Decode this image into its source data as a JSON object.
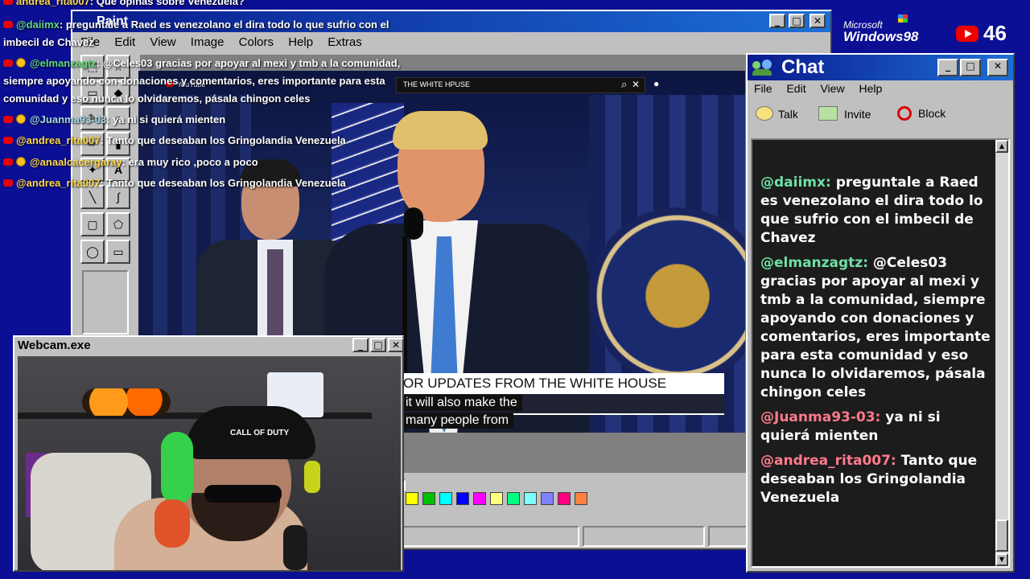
{
  "top_overlay": {
    "lines": [
      {
        "user": "andrea_rita007",
        "text": ": Que opinas sobre Venezuela?"
      },
      {
        "user": "@daiimx",
        "text": ": preguntale a Raed es venezolano el dira todo lo que sufrio con el"
      },
      {
        "cont": "imbecil de Chavez"
      },
      {
        "user": "@elmanzagtz",
        "text": ": @Celes03 gracias por apoyar al mexi y tmb a la comunidad,"
      },
      {
        "cont": "siempre apoyando con donaciones y comentarios, eres importante para esta"
      },
      {
        "cont": "comunidad y eso nunca lo olvidaremos, pásala chingon celes"
      },
      {
        "user": "@Juanma93-03",
        "text": ": ya ni si quierá mienten"
      },
      {
        "user": "@andrea_rita007",
        "text": ": Tanto que deseaban los Gringolandia Venezuela"
      },
      {
        "user": "@anaalcacergaray",
        "text": ": era muy rico ,poco a poco"
      },
      {
        "user": "@andrea_rita007",
        "text": ": Tanto que deseaban los Gringolandia Venezuela"
      }
    ]
  },
  "brand": {
    "microsoft": "Microsoft",
    "windows": "Windows98",
    "viewers": "46"
  },
  "paint": {
    "title": "Paint",
    "menu": [
      "File",
      "Edit",
      "View",
      "Image",
      "Colors",
      "Help",
      "Extras"
    ],
    "palette": [
      "#ffff00",
      "#00c000",
      "#00ffff",
      "#0000ff",
      "#ff00ff",
      "#ffff80",
      "#00ff80",
      "#80ffff",
      "#8080ff",
      "#ff0080",
      "#ff8040"
    ]
  },
  "video": {
    "search_text": "THE WHITE HPUSE",
    "youtube": "YouTube",
    "banner": "OR UPDATES FROM THE WHITE HOUSE",
    "caption1": "it will also make the",
    "caption2": "many people from"
  },
  "webcam": {
    "title": "Webcam.exe",
    "cap": "CALL OF DUTY"
  },
  "chat": {
    "title": "Chat",
    "menu": [
      "File",
      "Edit",
      "View",
      "Help"
    ],
    "toolbar": {
      "talk": "Talk",
      "invite": "Invite",
      "block": "Block"
    },
    "messages": [
      {
        "user": "@daiimx:",
        "text": " preguntale a Raed es venezolano el dira todo lo que sufrio con el imbecil de Chavez"
      },
      {
        "user": "@elmanzagtz:",
        "text": " @Celes03 gracias por apoyar al mexi y tmb a la comunidad, siempre apoyando con donaciones y comentarios, eres importante para esta comunidad y eso nunca lo olvidaremos, pásala chingon celes"
      },
      {
        "user": "@Juanma93-03:",
        "text": " ya ni si quierá mienten"
      },
      {
        "user": "@andrea_rita007:",
        "text": " Tanto que deseaban los Gringolandia Venezuela"
      }
    ]
  }
}
